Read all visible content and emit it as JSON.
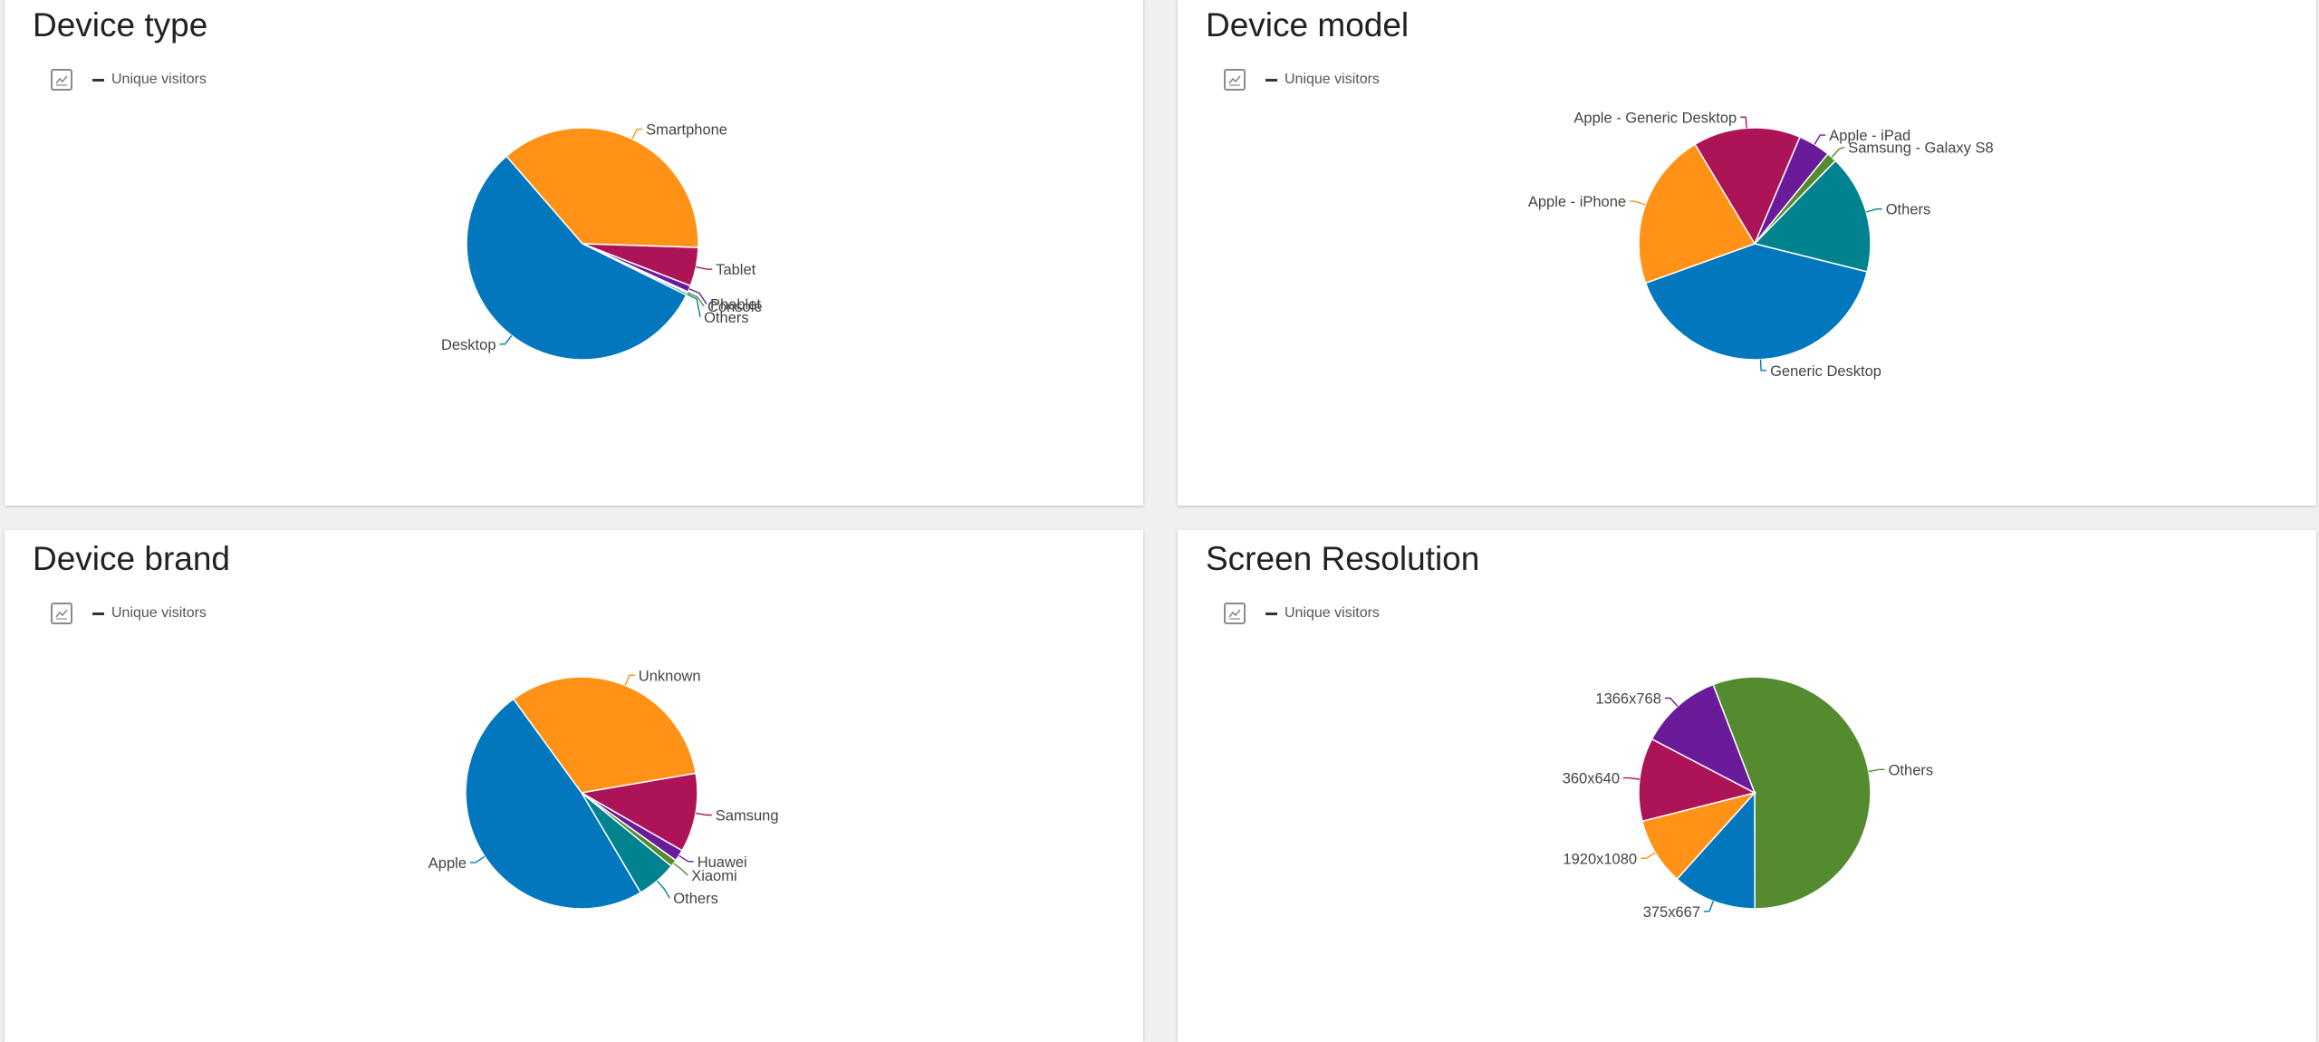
{
  "legend_label": "Unique visitors",
  "chart_data": [
    {
      "type": "pie",
      "title": "Device type",
      "legend": [
        "Unique visitors"
      ],
      "slices": [
        {
          "label": "Smartphone",
          "value": 36.9,
          "color": "#ff9217"
        },
        {
          "label": "Tablet",
          "value": 5.4,
          "color": "#ad1457"
        },
        {
          "label": "Phablet",
          "value": 0.9,
          "color": "#6a1b9a"
        },
        {
          "label": "Console",
          "value": 0.2,
          "color": "#558b2f"
        },
        {
          "label": "Others",
          "value": 0.3,
          "color": "#00838f"
        },
        {
          "label": "Desktop",
          "value": 56.3,
          "color": "#0277bd"
        }
      ]
    },
    {
      "type": "pie",
      "title": "Device model",
      "legend": [
        "Unique visitors"
      ],
      "slices": [
        {
          "label": "Apple - Generic Desktop",
          "value": 15.0,
          "color": "#ad1457"
        },
        {
          "label": "Apple - iPad",
          "value": 4.5,
          "color": "#6a1b9a"
        },
        {
          "label": "Samsung - Galaxy S8",
          "value": 1.4,
          "color": "#558b2f"
        },
        {
          "label": "Others",
          "value": 16.6,
          "color": "#00838f"
        },
        {
          "label": "Generic Desktop",
          "value": 40.6,
          "color": "#0277bd"
        },
        {
          "label": "Apple - iPhone",
          "value": 21.9,
          "color": "#ff9217"
        }
      ]
    },
    {
      "type": "pie",
      "title": "Device brand",
      "legend": [
        "Unique visitors"
      ],
      "slices": [
        {
          "label": "Unknown",
          "value": 32.3,
          "color": "#ff9217"
        },
        {
          "label": "Samsung",
          "value": 11.0,
          "color": "#ad1457"
        },
        {
          "label": "Huawei",
          "value": 1.6,
          "color": "#6a1b9a"
        },
        {
          "label": "Xiaomi",
          "value": 1.0,
          "color": "#558b2f"
        },
        {
          "label": "Others",
          "value": 5.6,
          "color": "#00838f"
        },
        {
          "label": "Apple",
          "value": 48.5,
          "color": "#0277bd"
        }
      ]
    },
    {
      "type": "pie",
      "title": "Screen Resolution",
      "legend": [
        "Unique visitors"
      ],
      "slices": [
        {
          "label": "Others",
          "value": 55.8,
          "color": "#558b2f"
        },
        {
          "label": "375x667",
          "value": 11.7,
          "color": "#0277bd"
        },
        {
          "label": "1920x1080",
          "value": 9.4,
          "color": "#ff9217"
        },
        {
          "label": "360x640",
          "value": 11.6,
          "color": "#ad1457"
        },
        {
          "label": "1366x768",
          "value": 11.5,
          "color": "#6a1b9a"
        }
      ]
    }
  ]
}
